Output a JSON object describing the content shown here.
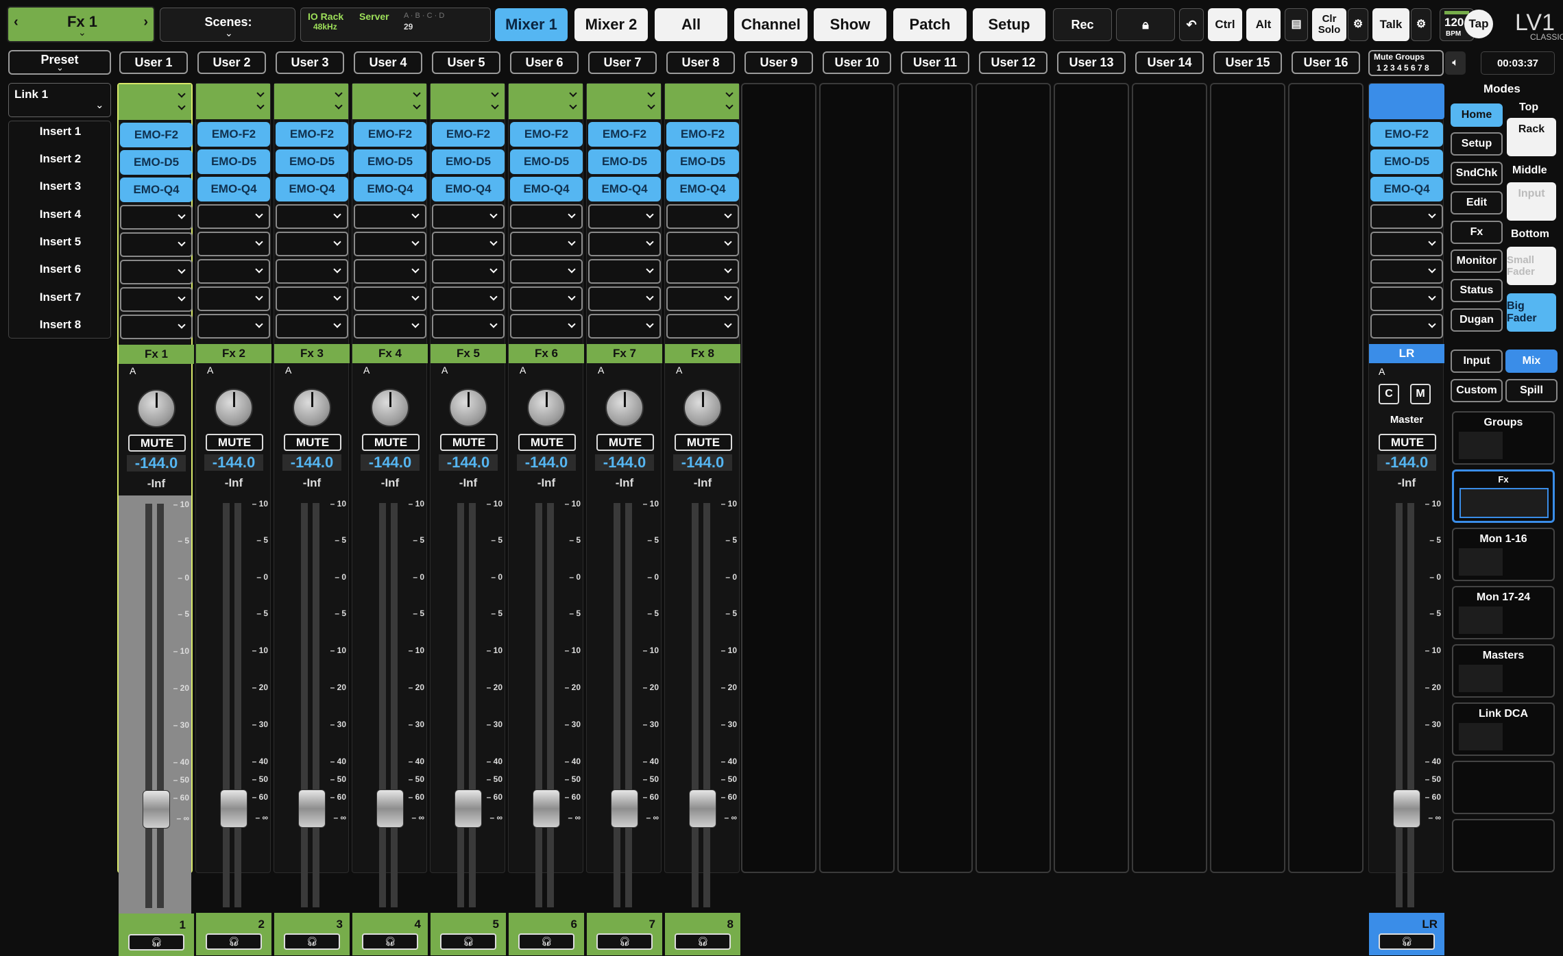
{
  "topbar": {
    "fx_title": "Fx 1",
    "scenes_label": "Scenes:",
    "io_rack": "IO Rack",
    "sample_rate": "48kHz",
    "server": "Server",
    "abcd": "A · B · C · D",
    "scene_num": "29",
    "tabs": [
      "Mixer 1",
      "Mixer 2",
      "All",
      "Channel",
      "Show",
      "Patch",
      "Setup"
    ],
    "rec": "Rec",
    "ctrl": "Ctrl",
    "alt": "Alt",
    "clr_solo": "Clr Solo",
    "talk": "Talk",
    "bpm": "120",
    "bpm_unit": "BPM",
    "tap": "Tap",
    "logo": "LV1",
    "logo_sub": "CLASSIC",
    "clock": "00:03:37"
  },
  "row2": {
    "preset": "Preset",
    "users": [
      "User 1",
      "User 2",
      "User 3",
      "User 4",
      "User 5",
      "User 6",
      "User 7",
      "User 8",
      "User 9",
      "User 10",
      "User 11",
      "User 12",
      "User 13",
      "User 14",
      "User 15",
      "User 16"
    ],
    "mute_groups_title": "Mute Groups",
    "mute_groups_nums": "1 2 3 4 5 6 7 8"
  },
  "left": {
    "link": "Link 1",
    "inserts": [
      "Insert 1",
      "Insert 2",
      "Insert 3",
      "Insert 4",
      "Insert 5",
      "Insert 6",
      "Insert 7",
      "Insert 8"
    ]
  },
  "channels": [
    {
      "name": "Fx 1",
      "num": "1"
    },
    {
      "name": "Fx 2",
      "num": "2"
    },
    {
      "name": "Fx 3",
      "num": "3"
    },
    {
      "name": "Fx 4",
      "num": "4"
    },
    {
      "name": "Fx 5",
      "num": "5"
    },
    {
      "name": "Fx 6",
      "num": "6"
    },
    {
      "name": "Fx 7",
      "num": "7"
    },
    {
      "name": "Fx 8",
      "num": "8"
    }
  ],
  "plugins": [
    "EMO-F2",
    "EMO-D5",
    "EMO-Q4"
  ],
  "strip_common": {
    "a": "A",
    "mute": "MUTE",
    "db": "-144.0",
    "inf": "-Inf"
  },
  "scale": [
    "10",
    "5",
    "0",
    "5",
    "10",
    "20",
    "30",
    "40",
    "50",
    "60",
    "∞"
  ],
  "master": {
    "name": "LR",
    "c": "C",
    "m": "M",
    "label": "Master",
    "num": "LR"
  },
  "right": {
    "modes": "Modes",
    "top": "Top",
    "middle": "Middle",
    "bottom": "Bottom",
    "mode_buttons": [
      "Home",
      "Setup",
      "SndChk",
      "Edit",
      "Fx",
      "Monitor",
      "Status",
      "Dugan"
    ],
    "rack": "Rack",
    "input_mid": "Input",
    "small_fader": "Small Fader",
    "big_fader": "Big Fader",
    "input": "Input",
    "mix": "Mix",
    "custom": "Custom",
    "spill": "Spill",
    "panels": [
      "Groups",
      "Fx",
      "Mon 1-16",
      "Mon 17-24",
      "Masters",
      "Link DCA"
    ]
  },
  "colors": {
    "accent_blue": "#55b6f2",
    "green": "#77ad4b"
  }
}
